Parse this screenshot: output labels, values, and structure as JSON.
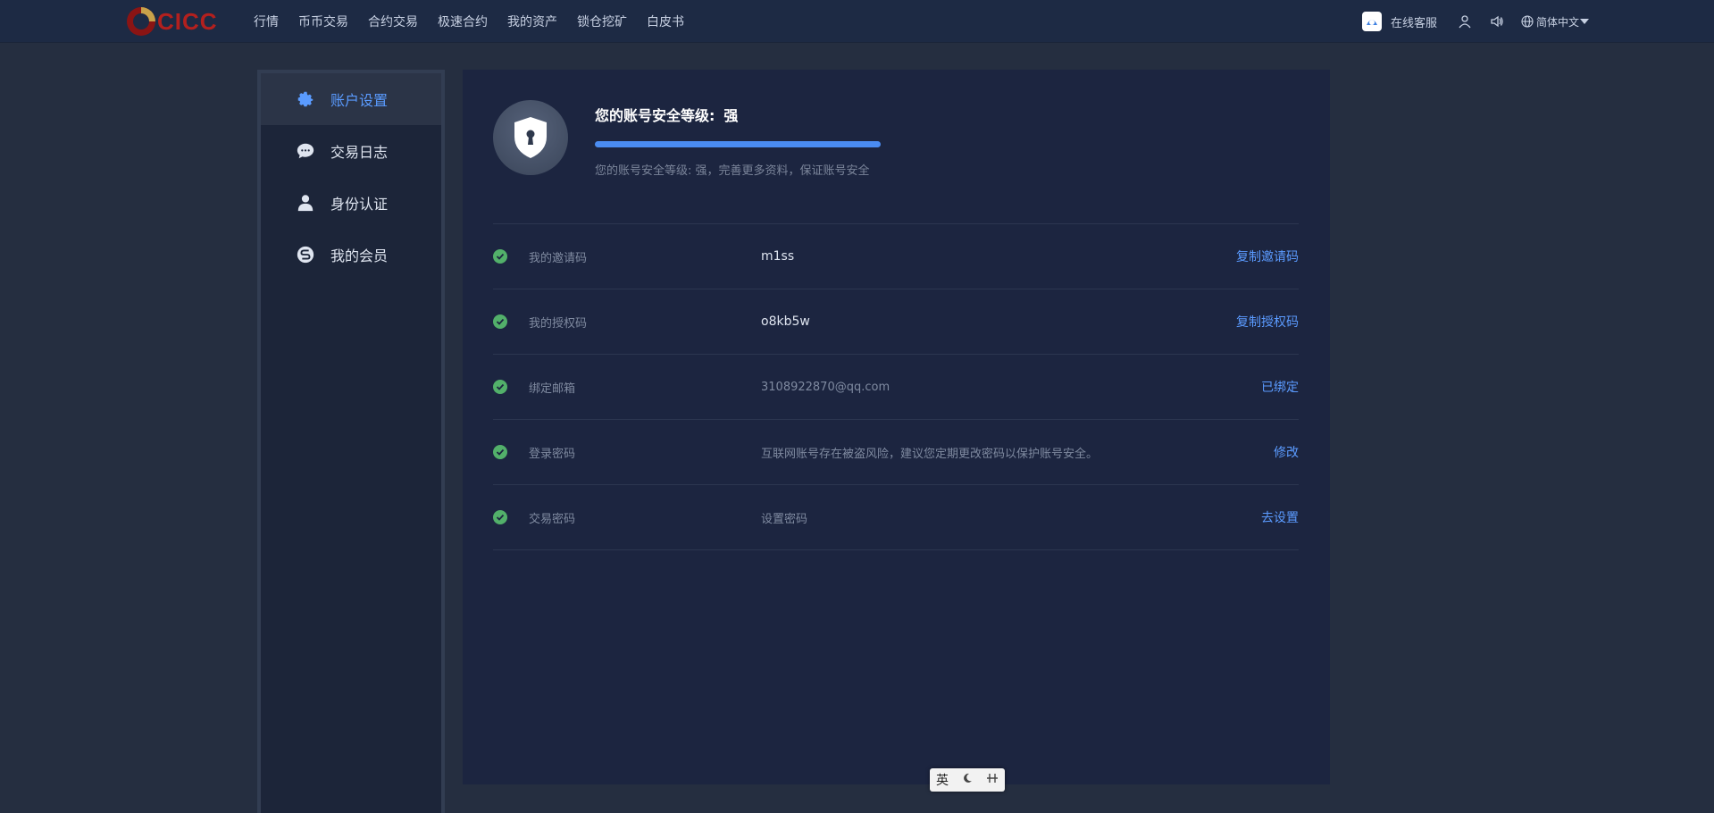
{
  "header": {
    "logo_text": "CICC",
    "nav": [
      "行情",
      "币币交易",
      "合约交易",
      "极速合约",
      "我的资产",
      "锁仓挖矿",
      "白皮书"
    ],
    "service_label": "在线客服",
    "language": "简体中文"
  },
  "sidebar": {
    "items": [
      {
        "label": "账户设置",
        "icon": "gear-icon",
        "active": true
      },
      {
        "label": "交易日志",
        "icon": "chat-icon",
        "active": false
      },
      {
        "label": "身份认证",
        "icon": "user-icon",
        "active": false
      },
      {
        "label": "我的会员",
        "icon": "member-icon",
        "active": false
      }
    ]
  },
  "security": {
    "title": "您的账号安全等级:",
    "level": "强",
    "progress_percent": 100,
    "note": "您的账号安全等级: 强，完善更多资料，保证账号安全"
  },
  "rows": [
    {
      "label": "我的邀请码",
      "value": "m1ss",
      "dim": false,
      "action": "复制邀请码"
    },
    {
      "label": "我的授权码",
      "value": "o8kb5w",
      "dim": false,
      "action": "复制授权码"
    },
    {
      "label": "绑定邮箱",
      "value": "3108922870@qq.com",
      "dim": true,
      "action": "已绑定"
    },
    {
      "label": "登录密码",
      "value": "互联网账号存在被盗风险，建议您定期更改密码以保护账号安全。",
      "dim": true,
      "action": "修改"
    },
    {
      "label": "交易密码",
      "value": "设置密码",
      "dim": true,
      "action": "去设置"
    }
  ],
  "ime": {
    "mode": "英"
  },
  "colors": {
    "accent": "#5b9bff",
    "success": "#52b06a",
    "brand": "#b3201e"
  }
}
